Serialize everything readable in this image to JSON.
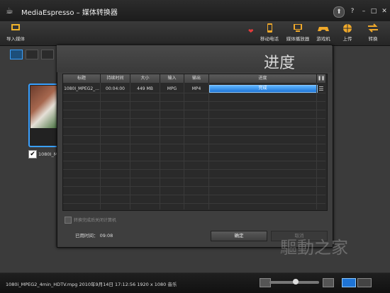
{
  "window": {
    "title": "MediaEspresso – 媒体转换器"
  },
  "toolbar": {
    "import_label": "导入媒体",
    "items": [
      {
        "label": "移动电话"
      },
      {
        "label": "媒体播放器"
      },
      {
        "label": "游戏机"
      },
      {
        "label": "上传"
      },
      {
        "label": "转换"
      }
    ]
  },
  "thumbnail": {
    "name": "1080I_MPI",
    "checked": true
  },
  "dialog": {
    "title": "进度",
    "columns": [
      "标题",
      "持续时间",
      "大小",
      "输入",
      "输出",
      "进度"
    ],
    "rows": [
      {
        "title": "1080I_MPEG2_...",
        "duration": "00:04:00",
        "size": "449 MB",
        "input": "MPG",
        "output": "MP4",
        "progress_label": "完成",
        "progress": 1.0
      }
    ],
    "shutdown_label": "转换完成后关闭计算机",
    "elapsed_label": "已用时间：",
    "elapsed_value": "09:08",
    "ok_label": "确定",
    "cancel_label": "取消"
  },
  "statusbar": {
    "text": "1080i_MPEG2_4min_HDTV.mpg  2010年9月14日 17:12:56  1920 x 1080  音乐"
  },
  "watermark": "驅動之家",
  "icons": [
    "coffee-icon",
    "up-icon",
    "help-icon",
    "minimize-icon",
    "maximize-icon",
    "close-icon",
    "heart-icon",
    "phone-icon",
    "player-icon",
    "gamepad-icon",
    "upload-icon",
    "convert-icon"
  ]
}
